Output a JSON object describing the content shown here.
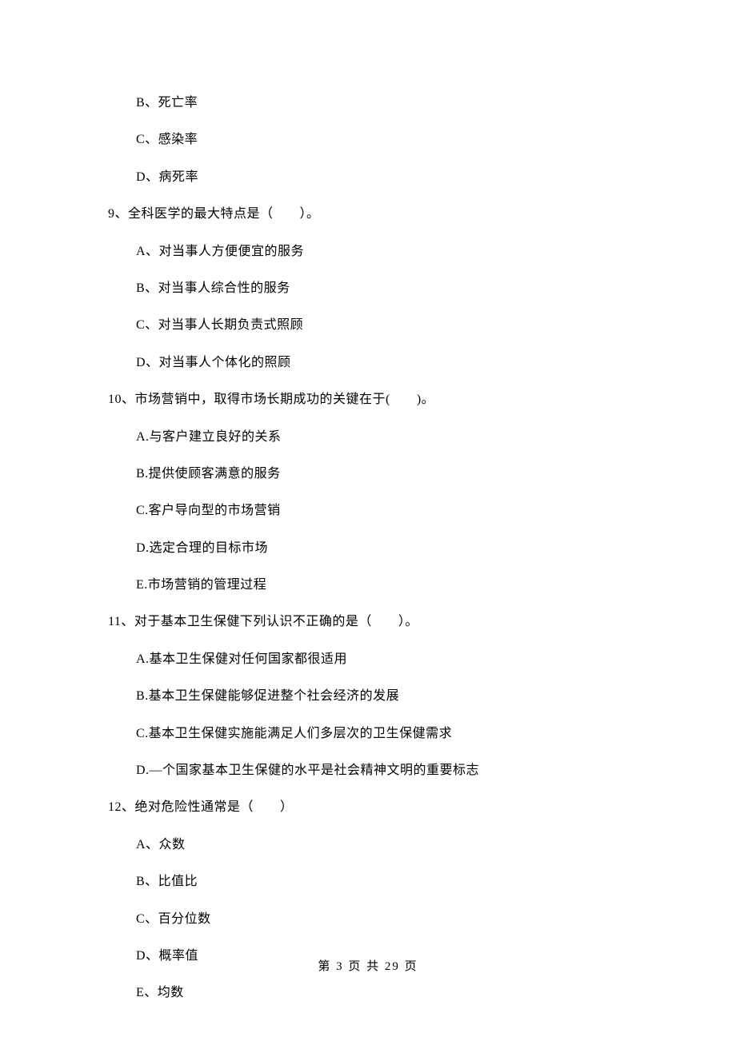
{
  "options_top": [
    "B、死亡率",
    "C、感染率",
    "D、病死率"
  ],
  "q9": {
    "text": "9、全科医学的最大特点是（　　）。",
    "opts": [
      "A、对当事人方便便宜的服务",
      "B、对当事人综合性的服务",
      "C、对当事人长期负责式照顾",
      "D、对当事人个体化的照顾"
    ]
  },
  "q10": {
    "text": "10、市场营销中，取得市场长期成功的关键在于(　　)。",
    "opts": [
      "A.与客户建立良好的关系",
      "B.提供使顾客满意的服务",
      "C.客户导向型的市场营销",
      "D.选定合理的目标市场",
      "E.市场营销的管理过程"
    ]
  },
  "q11": {
    "text": "11、对于基本卫生保健下列认识不正确的是（　　）。",
    "opts": [
      "A.基本卫生保健对任何国家都很适用",
      "B.基本卫生保健能够促进整个社会经济的发展",
      "C.基本卫生保健实施能满足人们多层次的卫生保健需求",
      "D.—个国家基本卫生保健的水平是社会精神文明的重要标志"
    ]
  },
  "q12": {
    "text": "12、绝对危险性通常是（　　）",
    "opts": [
      "A、众数",
      "B、比值比",
      "C、百分位数",
      "D、概率值",
      "E、均数"
    ]
  },
  "footer": "第 3 页 共 29 页"
}
